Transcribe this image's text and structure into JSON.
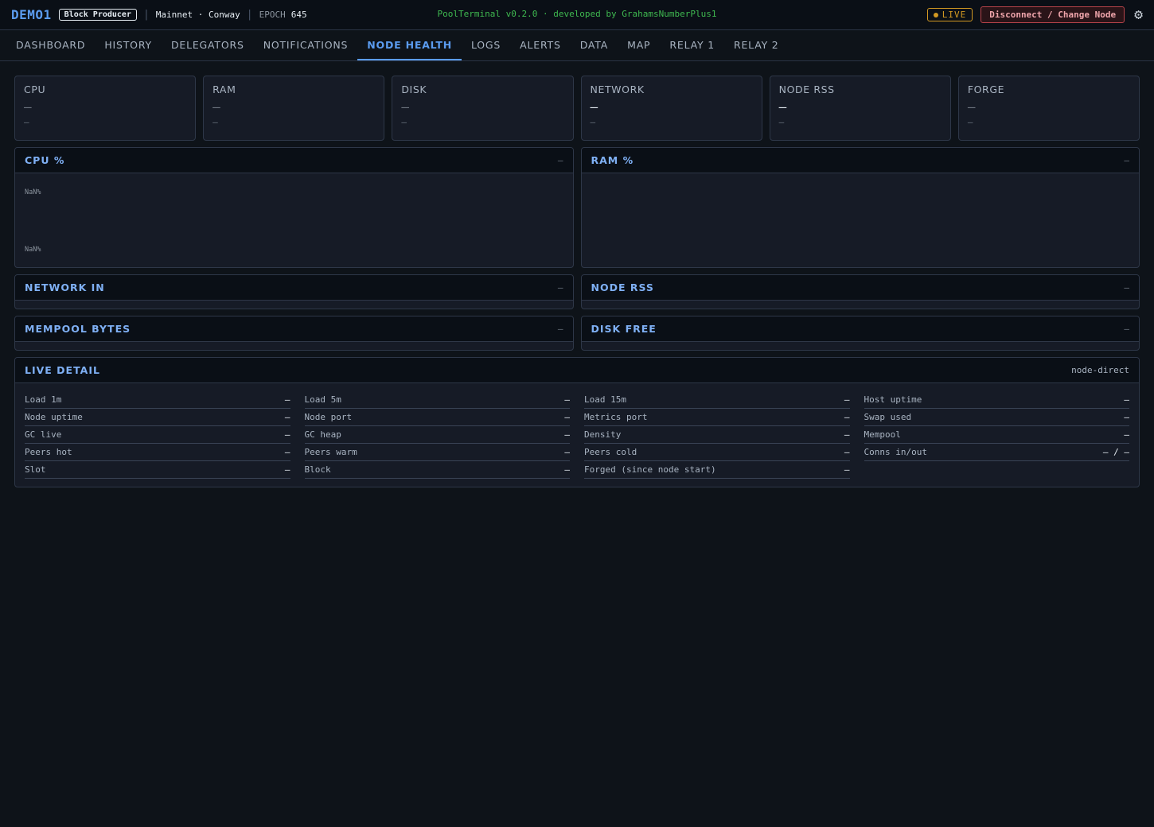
{
  "header": {
    "brand": "DEMO1",
    "role": "Block Producer",
    "network": "Mainnet · Conway",
    "epoch_label": "EPOCH",
    "epoch_value": "645",
    "credit": "PoolTerminal v0.2.0 · developed by GrahamsNumberPlus1",
    "live_label": "LIVE",
    "disconnect_label": "Disconnect / Change Node",
    "settings_glyph": "⚙"
  },
  "nav": {
    "tabs": [
      {
        "label": "DASHBOARD"
      },
      {
        "label": "HISTORY"
      },
      {
        "label": "DELEGATORS"
      },
      {
        "label": "NOTIFICATIONS"
      },
      {
        "label": "NODE HEALTH",
        "active": true
      },
      {
        "label": "LOGS"
      },
      {
        "label": "ALERTS"
      },
      {
        "label": "DATA"
      },
      {
        "label": "MAP"
      },
      {
        "label": "RELAY 1"
      },
      {
        "label": "RELAY 2"
      }
    ]
  },
  "stats": [
    {
      "title": "CPU",
      "value": "—",
      "sub": "–"
    },
    {
      "title": "RAM",
      "value": "—",
      "sub": "–"
    },
    {
      "title": "DISK",
      "value": "—",
      "sub": "–"
    },
    {
      "title": "NETWORK",
      "value": "—",
      "sub": "–",
      "bright": true
    },
    {
      "title": "NODE RSS",
      "value": "—",
      "sub": "–",
      "bright": true
    },
    {
      "title": "FORGE",
      "value": "—",
      "sub": "–"
    }
  ],
  "charts": {
    "cpu": {
      "title": "CPU %",
      "meta": "–",
      "axis_top": "NaN%",
      "axis_bottom": "NaN%"
    },
    "ram": {
      "title": "RAM %",
      "meta": "–"
    },
    "network_in": {
      "title": "NETWORK IN",
      "meta": "–"
    },
    "node_rss": {
      "title": "NODE RSS",
      "meta": "–"
    },
    "mempool_bytes": {
      "title": "MEMPOOL BYTES",
      "meta": "–"
    },
    "disk_free": {
      "title": "DISK FREE",
      "meta": "–"
    }
  },
  "live_detail": {
    "title": "LIVE DETAIL",
    "source": "node-direct",
    "columns": [
      [
        {
          "key": "Load 1m",
          "value": "–"
        },
        {
          "key": "Node uptime",
          "value": "–"
        },
        {
          "key": "GC live",
          "value": "–"
        },
        {
          "key": "Peers hot",
          "value": "–"
        },
        {
          "key": "Slot",
          "value": "–"
        }
      ],
      [
        {
          "key": "Load 5m",
          "value": "–"
        },
        {
          "key": "Node port",
          "value": "–"
        },
        {
          "key": "GC heap",
          "value": "–"
        },
        {
          "key": "Peers warm",
          "value": "–"
        },
        {
          "key": "Block",
          "value": "–"
        }
      ],
      [
        {
          "key": "Load 15m",
          "value": "–"
        },
        {
          "key": "Metrics port",
          "value": "–"
        },
        {
          "key": "Density",
          "value": "–"
        },
        {
          "key": "Peers cold",
          "value": "–"
        },
        {
          "key": "Forged (since node start)",
          "value": "–"
        }
      ],
      [
        {
          "key": "Host uptime",
          "value": "–"
        },
        {
          "key": "Swap used",
          "value": "–"
        },
        {
          "key": "Mempool",
          "value": "–"
        },
        {
          "key": "Conns in/out",
          "value": "– / –"
        }
      ]
    ]
  }
}
